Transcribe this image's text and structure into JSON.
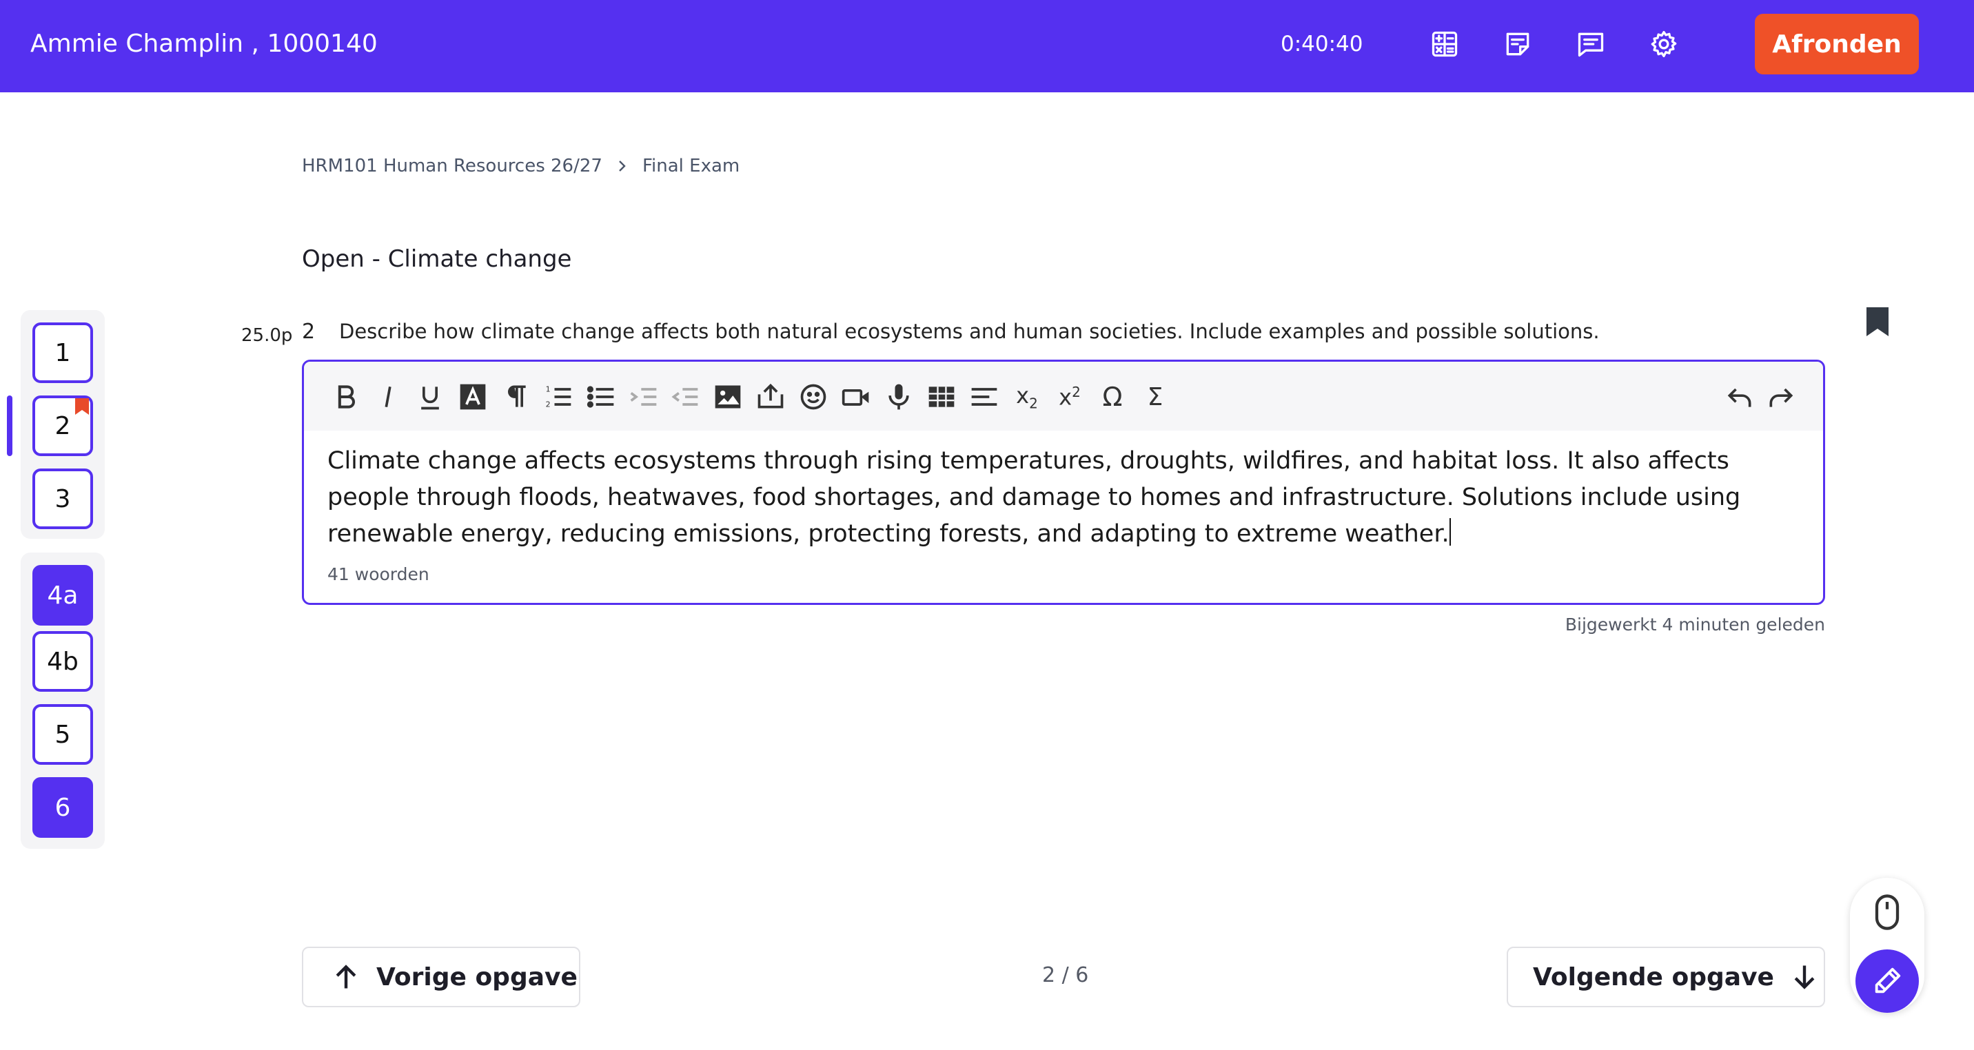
{
  "header": {
    "student": "Ammie Champlin , 1000140",
    "timer": "0:40:40",
    "finish_label": "Afronden",
    "icons": [
      "calculator-icon",
      "notes-icon",
      "chat-icon",
      "gear-icon"
    ]
  },
  "breadcrumb": {
    "course": "HRM101 Human Resources 26/27",
    "exam": "Final Exam"
  },
  "question": {
    "title": "Open - Climate change",
    "points": "25.0p",
    "number": "2",
    "text": "Describe how climate change affects both natural ecosystems and human societies. Include examples and possible solutions."
  },
  "sidebar": {
    "items": [
      {
        "label": "1",
        "state": "outline"
      },
      {
        "label": "2",
        "state": "outline",
        "flagged": true,
        "active": true
      },
      {
        "label": "3",
        "state": "outline"
      },
      {
        "label": "4a",
        "state": "filled"
      },
      {
        "label": "4b",
        "state": "outline"
      },
      {
        "label": "5",
        "state": "outline"
      },
      {
        "label": "6",
        "state": "filled"
      }
    ]
  },
  "editor": {
    "toolbar_subscript_label": "x",
    "toolbar_subscript_index": "2",
    "toolbar_superscript_label": "x",
    "toolbar_superscript_index": "2",
    "answer": "Climate change affects ecosystems through rising temperatures, droughts, wildfires, and habitat loss. It also affects people through floods, heatwaves, food shortages, and damage to homes and infrastructure. Solutions include using renewable energy, reducing emissions, protecting forests, and adapting to extreme weather.",
    "word_count": "41 woorden",
    "updated": "Bijgewerkt 4 minuten geleden"
  },
  "footer": {
    "prev_label": "Vorige opgave",
    "next_label": "Volgende opgave",
    "pager": "2 / 6"
  },
  "colors": {
    "primary": "#5530f0",
    "finish": "#ef5128",
    "flag": "#e84a2a"
  }
}
